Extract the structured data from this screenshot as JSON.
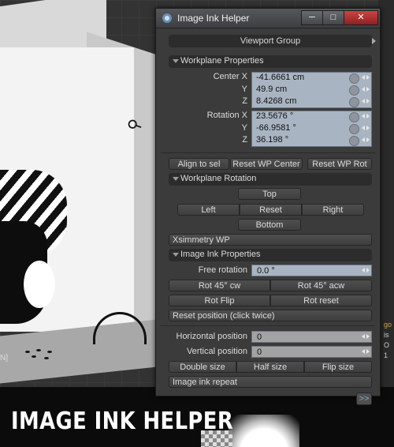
{
  "window": {
    "title": "Image Ink Helper",
    "minimize_label": "─",
    "maximize_label": "□",
    "close_label": "✕"
  },
  "viewport_group": {
    "label": "Viewport Group"
  },
  "workplane": {
    "section_label": "Workplane Properties",
    "center_label": "Center X",
    "center_y_label": "Y",
    "center_z_label": "Z",
    "center_x": "-41.6661 cm",
    "center_y": "49.9 cm",
    "center_z": "8.4268 cm",
    "rotation_label": "Rotation X",
    "rotation_y_label": "Y",
    "rotation_z_label": "Z",
    "rotation_x": "23.5676 °",
    "rotation_y": "-66.9581 °",
    "rotation_z": "36.198 °",
    "align_to_sel": "Align to sel",
    "reset_wp_center": "Reset WP Center",
    "reset_wp_rot": "Reset WP Rot"
  },
  "workplane_rotation": {
    "section_label": "Workplane Rotation",
    "top": "Top",
    "left": "Left",
    "reset": "Reset",
    "right": "Right",
    "bottom": "Bottom",
    "xsymmetry": "Xsimmetry WP"
  },
  "image_ink": {
    "section_label": "Image Ink Properties",
    "free_rotation_label": "Free rotation",
    "free_rotation_value": "0.0 °",
    "rot45_cw": "Rot 45° cw",
    "rot45_acw": "Rot 45° acw",
    "rot_flip": "Rot Flip",
    "rot_reset": "Rot reset",
    "reset_position": "Reset position (click twice)",
    "horizontal_label": "Horizontal position",
    "horizontal_value": "0",
    "vertical_label": "Vertical position",
    "vertical_value": "0",
    "double_size": "Double size",
    "half_size": "Half size",
    "flip_size": "Flip size",
    "repeat": "Image ink repeat",
    "go_button": ">>"
  },
  "viewport_labels": {
    "left_edge": "N]",
    "right_edge": [
      "go",
      "is",
      "O",
      "1"
    ]
  },
  "banner": {
    "text": "IMAGE INK HELPER"
  },
  "colors": {
    "panel_bg": "#3b3b3b",
    "field_blue": "#a9b4c2",
    "close_red": "#c44444"
  }
}
